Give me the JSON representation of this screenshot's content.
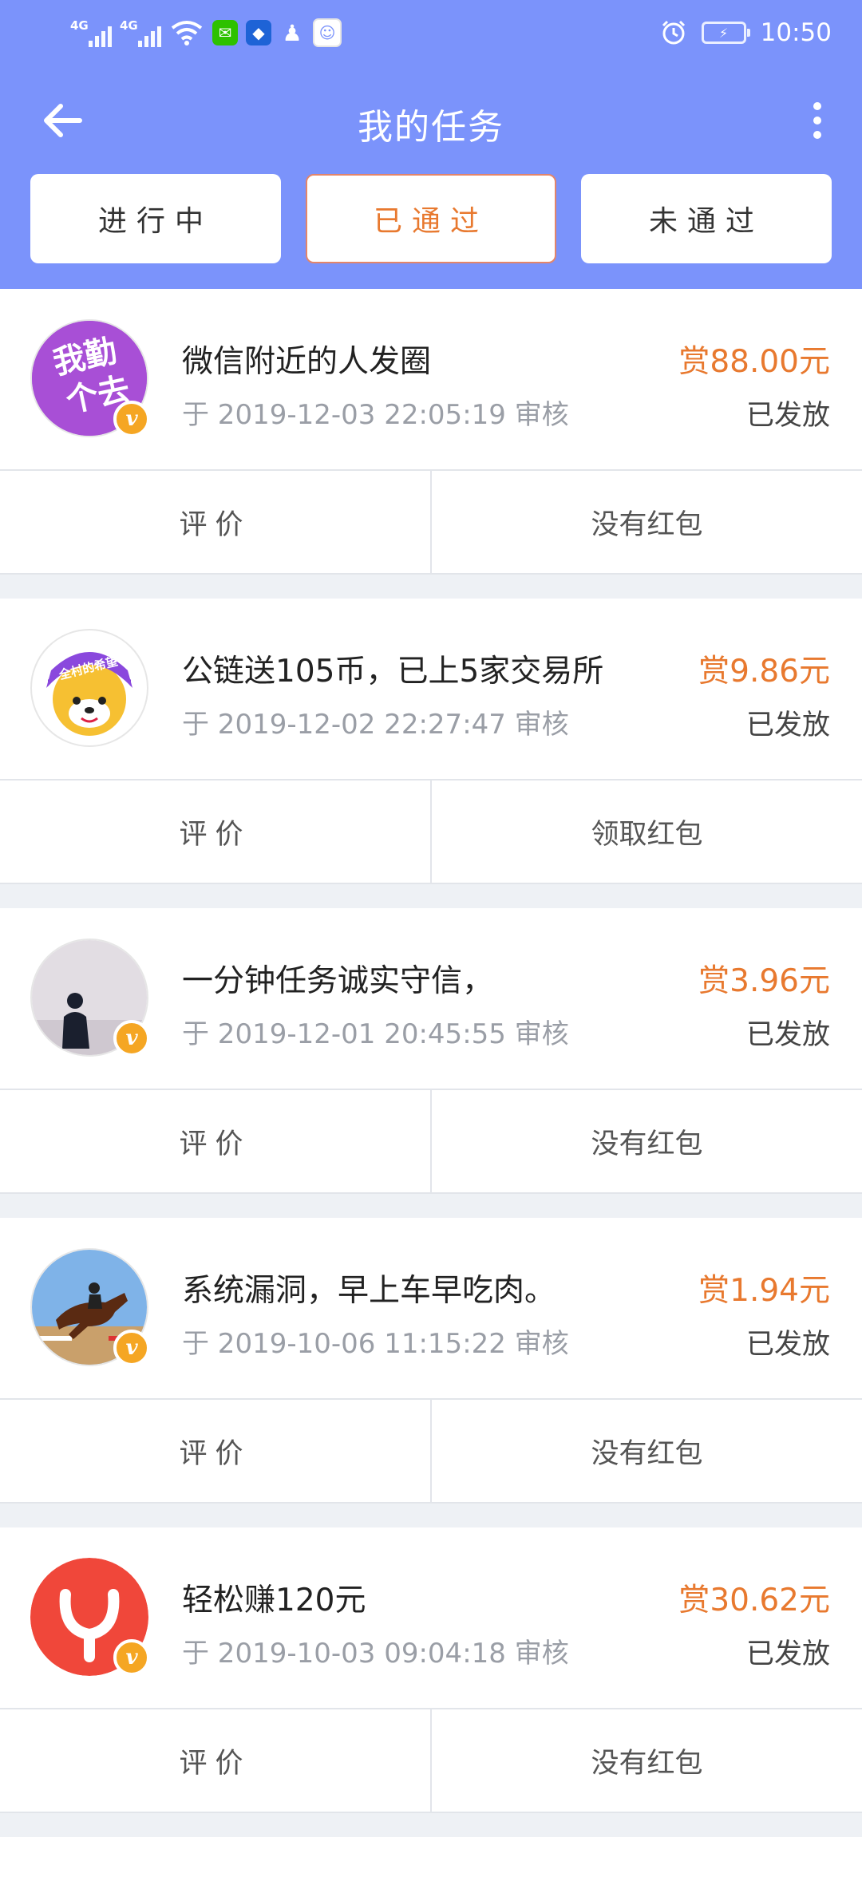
{
  "status_bar": {
    "signal1_label": "4G",
    "signal2_label": "4G",
    "time": "10:50"
  },
  "header": {
    "title": "我的任务"
  },
  "tabs": [
    {
      "label": "进行中",
      "active": false
    },
    {
      "label": "已通过",
      "active": true
    },
    {
      "label": "未通过",
      "active": false
    }
  ],
  "tasks": [
    {
      "avatar": "purple-text-avatar",
      "avatar_text": "我勤个去",
      "badge": "v",
      "title": "微信附近的人发圈",
      "date": "于 2019-12-03 22:05:19 审核",
      "reward": "赏88.00元",
      "status": "已发放",
      "review_label": "评价",
      "redpacket_label": "没有红包"
    },
    {
      "avatar": "shiba-dog-avatar",
      "avatar_text": "全村的希望",
      "badge": "",
      "title": "公链送105币，已上5家交易所",
      "date": "于 2019-12-02 22:27:47 审核",
      "reward": "赏9.86元",
      "status": "已发放",
      "review_label": "评价",
      "redpacket_label": "领取红包"
    },
    {
      "avatar": "person-silhouette-avatar",
      "badge": "v",
      "title": "一分钟任务诚实守信，",
      "date": "于 2019-12-01 20:45:55 审核",
      "reward": "赏3.96元",
      "status": "已发放",
      "review_label": "评价",
      "redpacket_label": "没有红包"
    },
    {
      "avatar": "horse-jump-avatar",
      "badge": "v",
      "title": "系统漏洞，早上车早吃肉。",
      "date": "于 2019-10-06 11:15:22 审核",
      "reward": "赏1.94元",
      "status": "已发放",
      "review_label": "评价",
      "redpacket_label": "没有红包"
    },
    {
      "avatar": "red-logo-avatar",
      "badge": "v",
      "title": "轻松赚120元",
      "date": "于 2019-10-03 09:04:18 审核",
      "reward": "赏30.62元",
      "status": "已发放",
      "review_label": "评价",
      "redpacket_label": "没有红包"
    }
  ],
  "colors": {
    "header_bg": "#7b93fb",
    "accent_orange": "#e8792f",
    "badge_orange": "#f5a623"
  }
}
